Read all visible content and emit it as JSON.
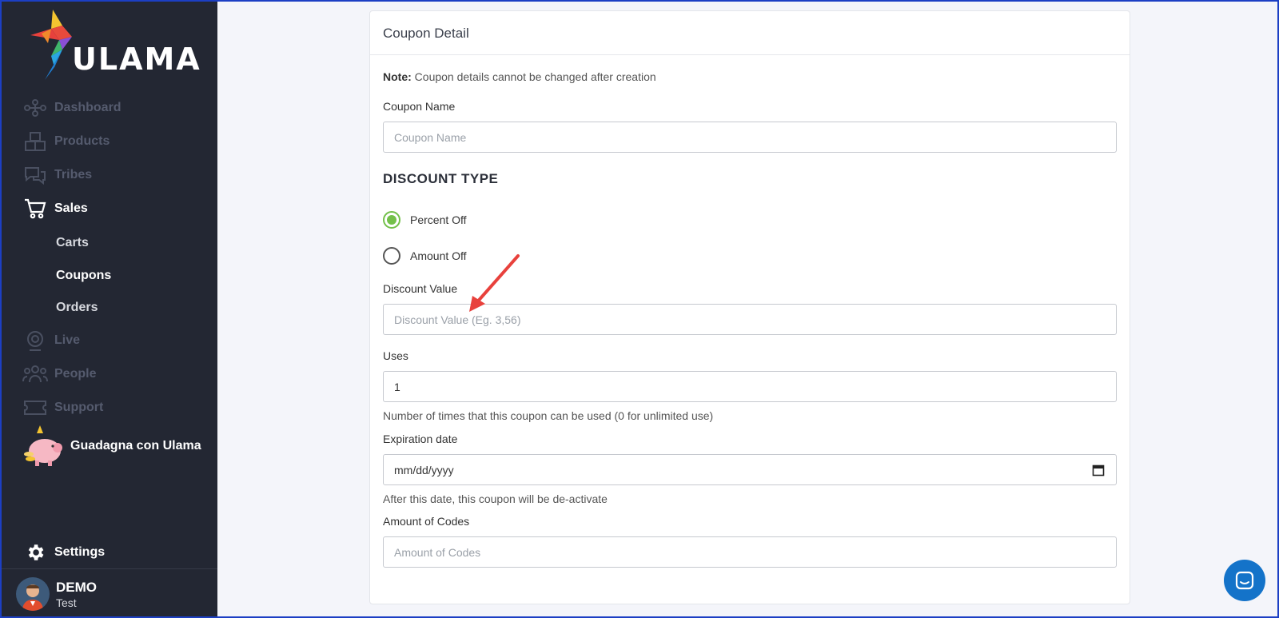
{
  "brand": {
    "logo_text": "ULAMA"
  },
  "sidebar": {
    "items": [
      {
        "label": "Dashboard",
        "icon": "network-icon"
      },
      {
        "label": "Products",
        "icon": "boxes-icon"
      },
      {
        "label": "Tribes",
        "icon": "chat-bubbles-icon"
      },
      {
        "label": "Sales",
        "icon": "cart-icon"
      },
      {
        "label": "Live",
        "icon": "webcam-icon"
      },
      {
        "label": "People",
        "icon": "people-icon"
      },
      {
        "label": "Support",
        "icon": "ticket-icon"
      }
    ],
    "sales_sub": [
      {
        "label": "Carts"
      },
      {
        "label": "Coupons"
      },
      {
        "label": "Orders"
      }
    ],
    "promo_label": "Guadagna con Ulama",
    "settings_label": "Settings",
    "user": {
      "name": "DEMO",
      "role": "Test"
    }
  },
  "card": {
    "title": "Coupon Detail",
    "note_bold": "Note:",
    "note_text": " Coupon details cannot be changed after creation",
    "coupon_name": {
      "label": "Coupon Name",
      "placeholder": "Coupon Name",
      "value": ""
    },
    "discount_type": {
      "heading": "DISCOUNT TYPE",
      "options": [
        {
          "label": "Percent Off",
          "selected": true
        },
        {
          "label": "Amount Off",
          "selected": false
        }
      ]
    },
    "discount_value": {
      "label": "Discount Value",
      "placeholder": "Discount Value (Eg. 3,56)",
      "value": ""
    },
    "uses": {
      "label": "Uses",
      "value": "1",
      "help": "Number of times that this coupon can be used (0 for unlimited use)"
    },
    "expiration": {
      "label": "Expiration date",
      "value": "mm/dd/yyyy",
      "help": "After this date, this coupon will be de-activate"
    },
    "amount_codes": {
      "label": "Amount of Codes",
      "placeholder": "Amount of Codes",
      "value": ""
    }
  },
  "colors": {
    "sidebar_bg": "#232733",
    "accent_green": "#73c04a",
    "annotation_red": "#e8413c",
    "chat_blue": "#1473c9"
  }
}
